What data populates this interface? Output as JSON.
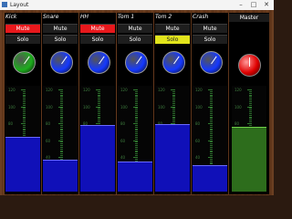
{
  "window": {
    "title": "Layout"
  },
  "channels": [
    {
      "name": "Kick",
      "mute_label": "Mute",
      "solo_label": "Solo",
      "mute_on": true,
      "solo_on": false,
      "knob_color": "#1cae1c",
      "level_percent": 51
    },
    {
      "name": "Snare",
      "mute_label": "Mute",
      "solo_label": "Solo",
      "mute_on": false,
      "solo_on": false,
      "knob_color": "#1438ff",
      "level_percent": 29
    },
    {
      "name": "HH",
      "mute_label": "Mute",
      "solo_label": "Solo",
      "mute_on": true,
      "solo_on": false,
      "knob_color": "#1438ff",
      "level_percent": 62
    },
    {
      "name": "Tom 1",
      "mute_label": "Mute",
      "solo_label": "Solo",
      "mute_on": false,
      "solo_on": false,
      "knob_color": "#1438ff",
      "level_percent": 28
    },
    {
      "name": "Tom 2",
      "mute_label": "Mute",
      "solo_label": "Solo",
      "mute_on": false,
      "solo_on": true,
      "knob_color": "#1438ff",
      "level_percent": 63
    },
    {
      "name": "Crash",
      "mute_label": "Mute",
      "solo_label": "Solo",
      "mute_on": false,
      "solo_on": false,
      "knob_color": "#1438ff",
      "level_percent": 24
    }
  ],
  "master": {
    "name": "Master",
    "knob_color": "#e00000",
    "level_percent": 60
  },
  "scale_labels": [
    "120",
    "100",
    "80",
    "60",
    "40",
    "20"
  ],
  "icons": {
    "minimize": "minimize-icon",
    "maximize": "maximize-icon",
    "close": "close-icon"
  }
}
